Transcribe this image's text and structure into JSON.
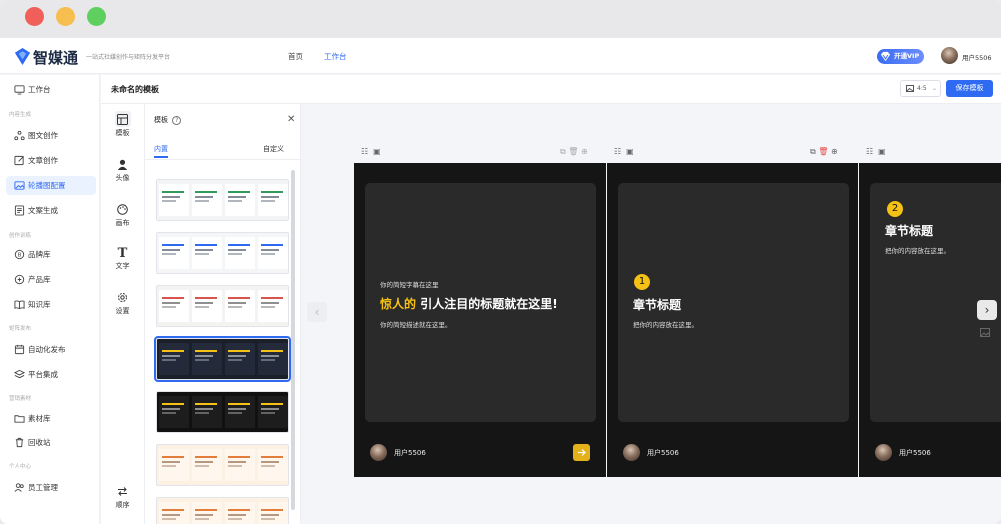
{
  "app": {
    "name": "智媒通",
    "slogan": "一站式社媒创作与矩阵分发平台"
  },
  "header": {
    "nav": [
      "首页",
      "工作台"
    ],
    "vip_label": "开通VIP",
    "user_name": "用户5506"
  },
  "sidebar": {
    "top_item": "工作台",
    "groups": [
      {
        "title": "内容生成",
        "items": [
          "图文创作",
          "文章创作",
          "轮播图配置",
          "文案生成"
        ]
      },
      {
        "title": "创作训练",
        "items": [
          "品牌库",
          "产品库",
          "知识库"
        ]
      },
      {
        "title": "矩阵发布",
        "items": [
          "自动化发布",
          "平台集成"
        ]
      },
      {
        "title": "营销素材",
        "items": [
          "素材库",
          "回收站"
        ]
      },
      {
        "title": "个人中心",
        "items": [
          "员工管理"
        ]
      }
    ],
    "active": "轮播图配置"
  },
  "editor": {
    "doc_title": "未命名的模板",
    "ratio": "4:5",
    "save_label": "保存模板"
  },
  "tools": [
    "模板",
    "头像",
    "画布",
    "文字",
    "设置",
    "顺序"
  ],
  "panel": {
    "title": "模板",
    "tabs": [
      "内置",
      "自定义"
    ],
    "active_tab": "内置"
  },
  "template_thumbs": [
    {
      "bg": "#f3f4f5",
      "card": "#ffffff",
      "accent": "#2f9a5a",
      "text": "#1e2a44"
    },
    {
      "bg": "#f5f6f8",
      "card": "#ffffff",
      "accent": "#2f6bf2",
      "text": "#1e2a44"
    },
    {
      "bg": "#f4f3f1",
      "card": "#ffffff",
      "accent": "#d9534f",
      "text": "#333333"
    },
    {
      "bg": "#1b1f2a",
      "card": "#232a3a",
      "accent": "#f5c114",
      "text": "#e8e8e8"
    },
    {
      "bg": "#111111",
      "card": "#1d1d1d",
      "accent": "#f5c114",
      "text": "#e8e8e8"
    },
    {
      "bg": "#fdf1e4",
      "card": "#fff7ee",
      "accent": "#e27d3a",
      "text": "#7a4a2a"
    },
    {
      "bg": "#fdf1e4",
      "card": "#fff7ee",
      "accent": "#e27d3a",
      "text": "#7a4a2a"
    }
  ],
  "slides": [
    {
      "subtitle_top": "你的简短字幕在这里",
      "highlight": "惊人的",
      "title": "引人注目的标题就在这里!",
      "desc": "你的简短描述就在这里。",
      "author": "用户5506"
    },
    {
      "num": "1",
      "title": "章节标题",
      "desc": "把你的内容放在这里。",
      "author": "用户5506"
    },
    {
      "num": "2",
      "title": "章节标题",
      "desc": "把你的内容放在这里。",
      "author": "用户5506"
    }
  ],
  "colors": {
    "primary": "#2f6bf2",
    "accent": "#f5c114",
    "slide_bg": "#151515",
    "slide_card": "#2a2a2a"
  }
}
